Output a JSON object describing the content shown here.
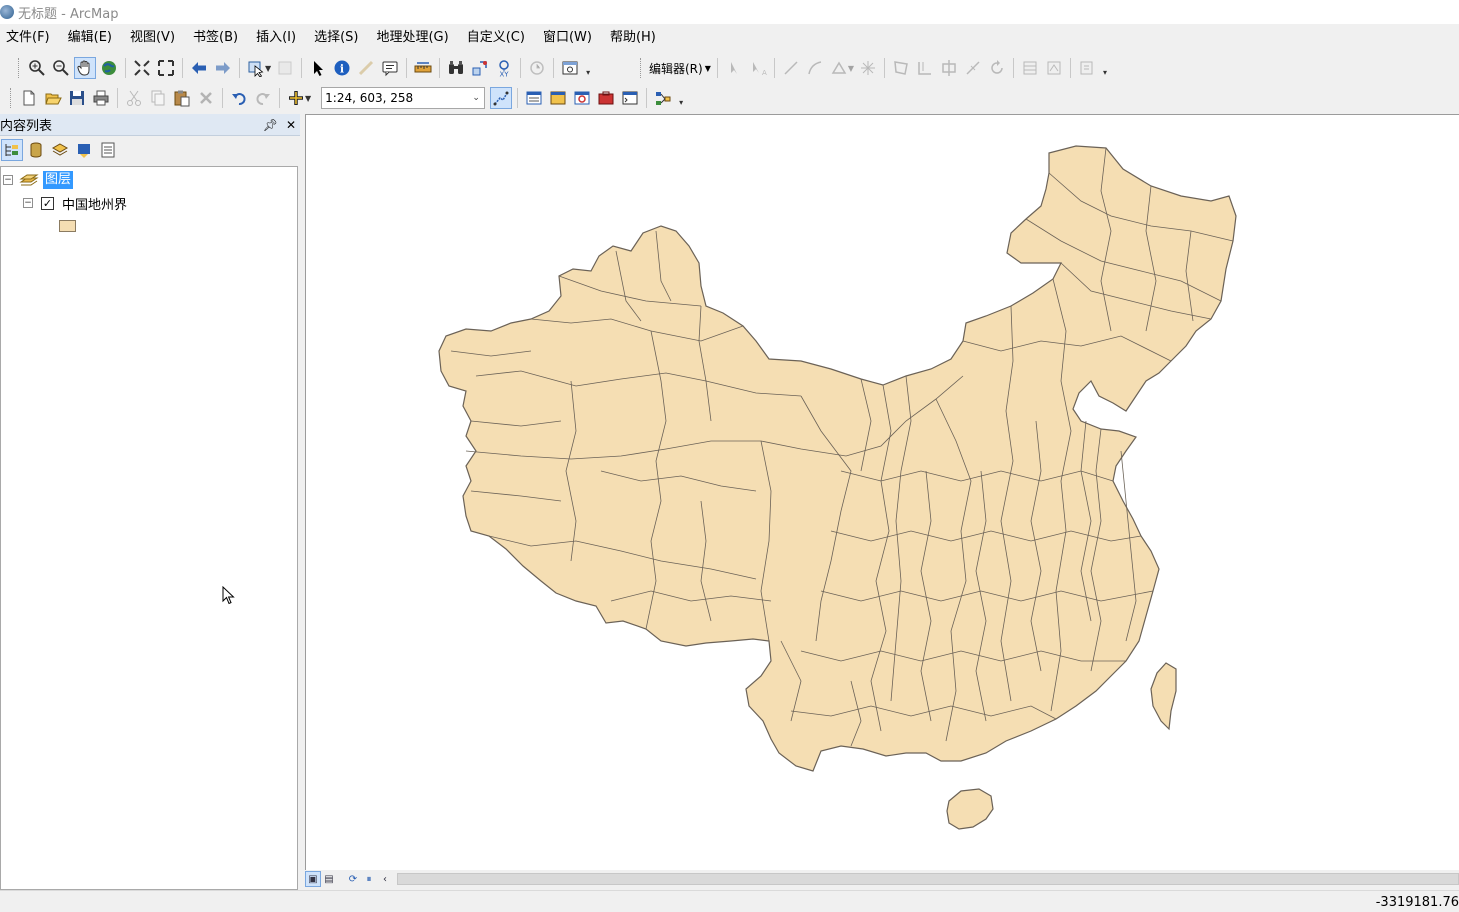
{
  "window": {
    "title": "无标题 - ArcMap"
  },
  "menu": [
    "文件(F)",
    "编辑(E)",
    "视图(V)",
    "书签(B)",
    "插入(I)",
    "选择(S)",
    "地理处理(G)",
    "自定义(C)",
    "窗口(W)",
    "帮助(H)"
  ],
  "tools": {
    "scale_value": "1:24, 603, 258",
    "editor_label": "编辑器(R)"
  },
  "toc": {
    "title": "内容列表",
    "group_label": "图层",
    "layer_label": "中国地州界",
    "layer_checked": true
  },
  "map": {
    "fill_color": "#f5deb3",
    "stroke_color": "#6b6257"
  },
  "status": {
    "coordinates": "-3319181.76"
  }
}
